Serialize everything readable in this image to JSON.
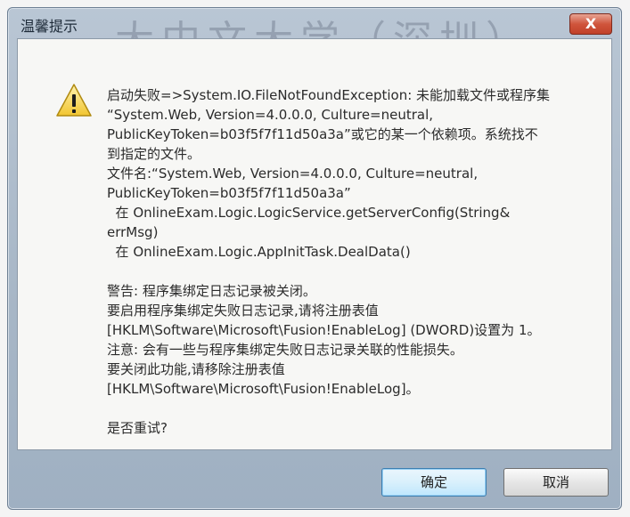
{
  "dialog": {
    "title": "温馨提示",
    "close_label": "X",
    "message": "启动失败=>System.IO.FileNotFoundException: 未能加载文件或程序集\n“System.Web, Version=4.0.0.0, Culture=neutral,\nPublicKeyToken=b03f5f7f11d50a3a”或它的某一个依赖项。系统找不\n到指定的文件。\n文件名:“System.Web, Version=4.0.0.0, Culture=neutral,\nPublicKeyToken=b03f5f7f11d50a3a”\n  在 OnlineExam.Logic.LogicService.getServerConfig(String&\nerrMsg)\n  在 OnlineExam.Logic.AppInitTask.DealData()\n\n警告: 程序集绑定日志记录被关闭。\n要启用程序集绑定失败日志记录,请将注册表值\n[HKLM\\Software\\Microsoft\\Fusion!EnableLog] (DWORD)设置为 1。\n注意: 会有一些与程序集绑定失败日志记录关联的性能损失。\n要关闭此功能,请移除注册表值\n[HKLM\\Software\\Microsoft\\Fusion!EnableLog]。\n\n是否重试?",
    "ok_label": "确定",
    "cancel_label": "取消",
    "icon": "warning-icon"
  }
}
